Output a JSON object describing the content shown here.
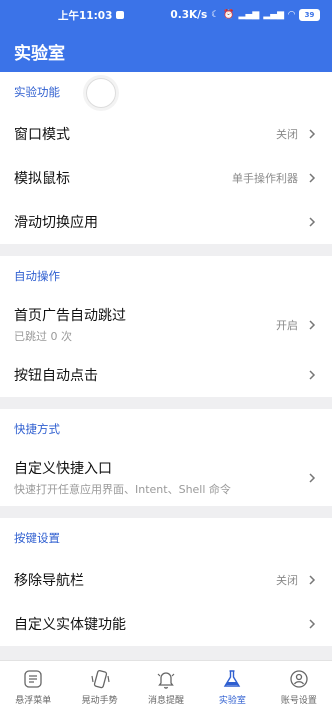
{
  "status_bar": {
    "time": "上午11:03",
    "speed": "0.3K/s",
    "battery": "39"
  },
  "app_bar": {
    "title": "实验室"
  },
  "sections": [
    {
      "header": "实验功能",
      "rows": [
        {
          "title": "窗口模式",
          "value": "关闭"
        },
        {
          "title": "模拟鼠标",
          "value": "单手操作利器"
        },
        {
          "title": "滑动切换应用",
          "value": ""
        }
      ]
    },
    {
      "header": "自动操作",
      "rows": [
        {
          "title": "首页广告自动跳过",
          "subtitle": "已跳过 0 次",
          "value": "开启"
        },
        {
          "title": "按钮自动点击",
          "value": ""
        }
      ]
    },
    {
      "header": "快捷方式",
      "rows": [
        {
          "title": "自定义快捷入口",
          "subtitle": "快速打开任意应用界面、Intent、Shell 命令",
          "value": ""
        }
      ]
    },
    {
      "header": "按键设置",
      "rows": [
        {
          "title": "移除导航栏",
          "value": "关闭"
        },
        {
          "title": "自定义实体键功能",
          "value": ""
        }
      ]
    }
  ],
  "bottom_nav": [
    {
      "label": "悬浮菜单",
      "icon": "floating-menu-icon"
    },
    {
      "label": "晃动手势",
      "icon": "shake-phone-icon"
    },
    {
      "label": "消息提醒",
      "icon": "bell-icon"
    },
    {
      "label": "实验室",
      "icon": "flask-icon",
      "active": true
    },
    {
      "label": "账号设置",
      "icon": "account-icon"
    }
  ],
  "colors": {
    "primary": "#3b73e8",
    "section_header": "#2f5fd0",
    "background": "#efeff1"
  }
}
